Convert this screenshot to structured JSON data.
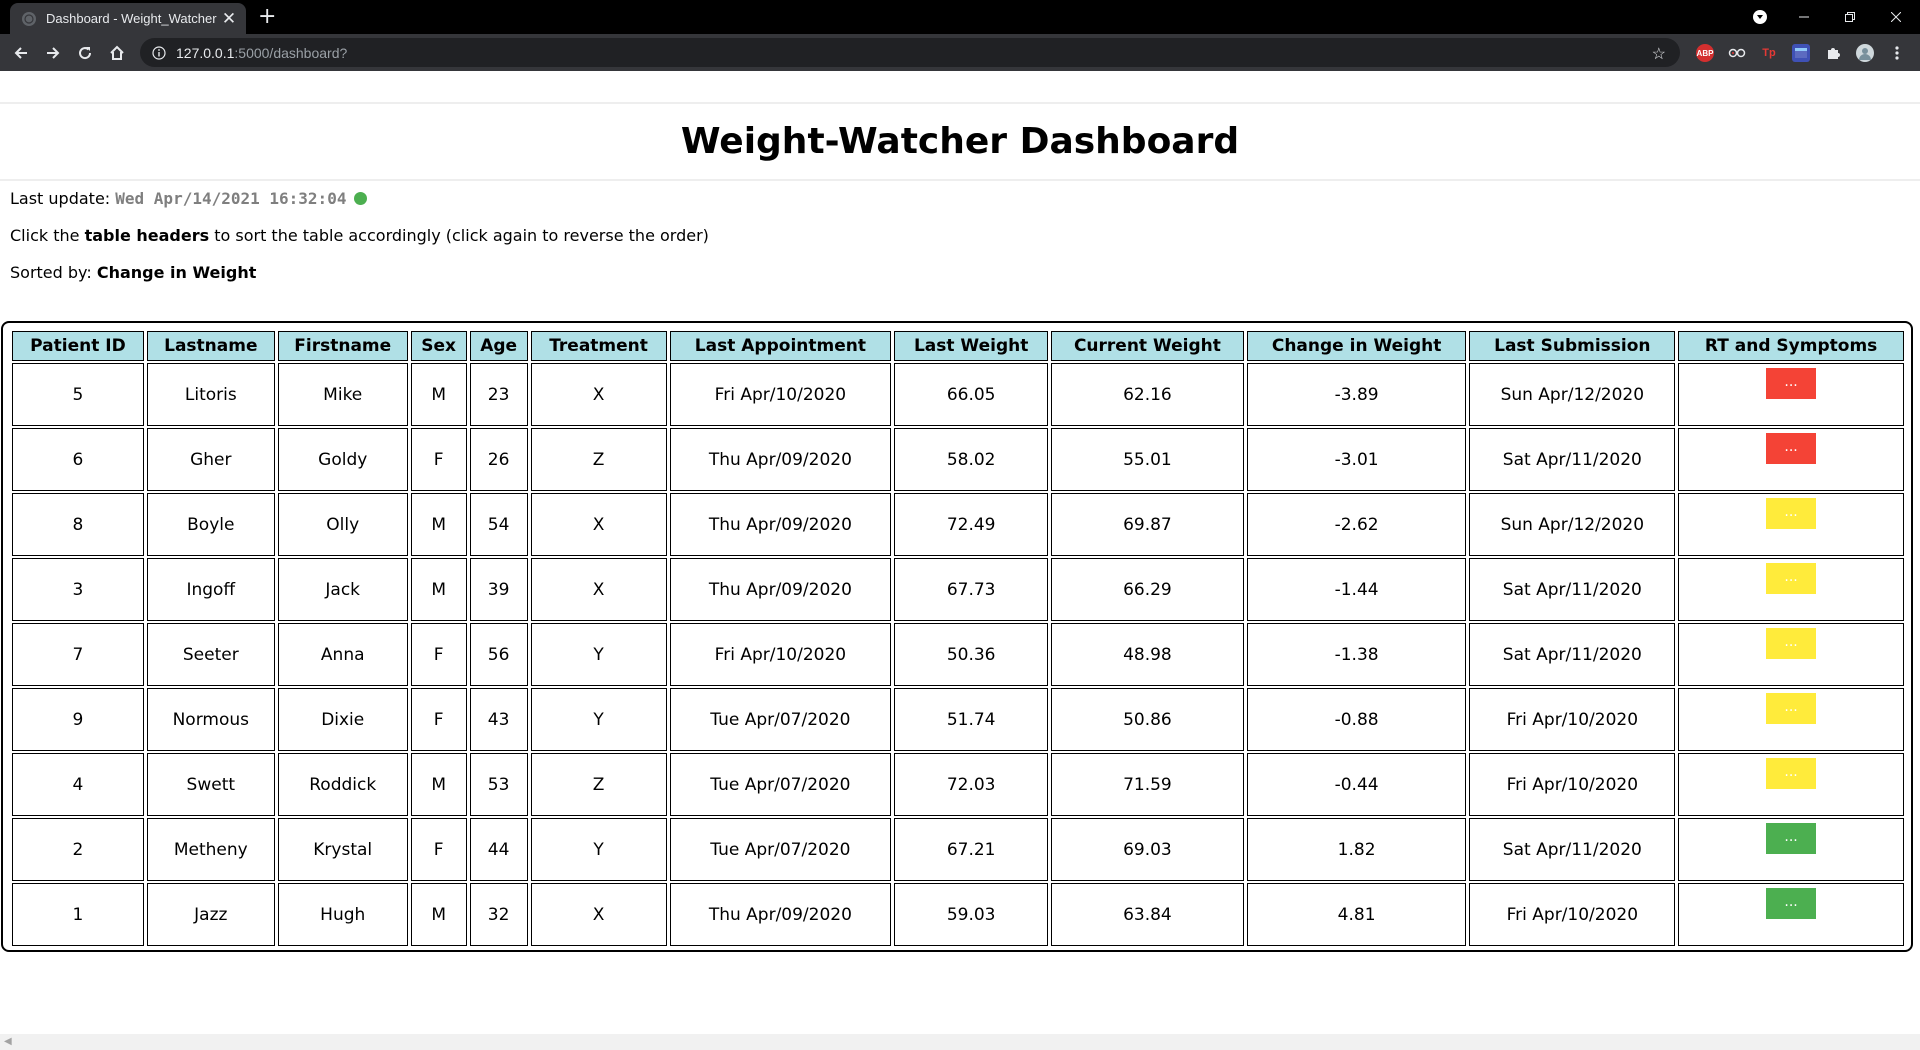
{
  "browser": {
    "tab_title": "Dashboard - Weight_Watcher",
    "tab_close": "✕",
    "new_tab": "+",
    "url_host": "127.0.0.1",
    "url_path": ":5000/dashboard?",
    "extensions": [
      "ABP",
      "Tp"
    ]
  },
  "page": {
    "title": "Weight-Watcher Dashboard",
    "last_update_label": "Last update: ",
    "last_update_value": "Wed Apr/14/2021 16:32:04",
    "status_color": "#4caf50",
    "instructions_pre": "Click the ",
    "instructions_bold": "table headers",
    "instructions_post": " to sort the table accordingly (click again to reverse the order)",
    "sorted_label": "Sorted by: ",
    "sorted_value": "Change in Weight"
  },
  "table": {
    "headers": [
      "Patient ID",
      "Lastname",
      "Firstname",
      "Sex",
      "Age",
      "Treatment",
      "Last Appointment",
      "Last Weight",
      "Current Weight",
      "Change in Weight",
      "Last Submission",
      "RT and Symptoms"
    ],
    "symptom_button_label": "...",
    "status_colors": {
      "red": "#f44336",
      "yellow": "#ffeb3b",
      "green": "#4caf50"
    },
    "rows": [
      {
        "id": "5",
        "lastname": "Litoris",
        "firstname": "Mike",
        "sex": "M",
        "age": "23",
        "treatment": "X",
        "last_appointment": "Fri Apr/10/2020",
        "last_weight": "66.05",
        "current_weight": "62.16",
        "change": "-3.89",
        "last_submission": "Sun Apr/12/2020",
        "status": "red"
      },
      {
        "id": "6",
        "lastname": "Gher",
        "firstname": "Goldy",
        "sex": "F",
        "age": "26",
        "treatment": "Z",
        "last_appointment": "Thu Apr/09/2020",
        "last_weight": "58.02",
        "current_weight": "55.01",
        "change": "-3.01",
        "last_submission": "Sat Apr/11/2020",
        "status": "red"
      },
      {
        "id": "8",
        "lastname": "Boyle",
        "firstname": "Olly",
        "sex": "M",
        "age": "54",
        "treatment": "X",
        "last_appointment": "Thu Apr/09/2020",
        "last_weight": "72.49",
        "current_weight": "69.87",
        "change": "-2.62",
        "last_submission": "Sun Apr/12/2020",
        "status": "yellow"
      },
      {
        "id": "3",
        "lastname": "Ingoff",
        "firstname": "Jack",
        "sex": "M",
        "age": "39",
        "treatment": "X",
        "last_appointment": "Thu Apr/09/2020",
        "last_weight": "67.73",
        "current_weight": "66.29",
        "change": "-1.44",
        "last_submission": "Sat Apr/11/2020",
        "status": "yellow"
      },
      {
        "id": "7",
        "lastname": "Seeter",
        "firstname": "Anna",
        "sex": "F",
        "age": "56",
        "treatment": "Y",
        "last_appointment": "Fri Apr/10/2020",
        "last_weight": "50.36",
        "current_weight": "48.98",
        "change": "-1.38",
        "last_submission": "Sat Apr/11/2020",
        "status": "yellow"
      },
      {
        "id": "9",
        "lastname": "Normous",
        "firstname": "Dixie",
        "sex": "F",
        "age": "43",
        "treatment": "Y",
        "last_appointment": "Tue Apr/07/2020",
        "last_weight": "51.74",
        "current_weight": "50.86",
        "change": "-0.88",
        "last_submission": "Fri Apr/10/2020",
        "status": "yellow"
      },
      {
        "id": "4",
        "lastname": "Swett",
        "firstname": "Roddick",
        "sex": "M",
        "age": "53",
        "treatment": "Z",
        "last_appointment": "Tue Apr/07/2020",
        "last_weight": "72.03",
        "current_weight": "71.59",
        "change": "-0.44",
        "last_submission": "Fri Apr/10/2020",
        "status": "yellow"
      },
      {
        "id": "2",
        "lastname": "Metheny",
        "firstname": "Krystal",
        "sex": "F",
        "age": "44",
        "treatment": "Y",
        "last_appointment": "Tue Apr/07/2020",
        "last_weight": "67.21",
        "current_weight": "69.03",
        "change": "1.82",
        "last_submission": "Sat Apr/11/2020",
        "status": "green"
      },
      {
        "id": "1",
        "lastname": "Jazz",
        "firstname": "Hugh",
        "sex": "M",
        "age": "32",
        "treatment": "X",
        "last_appointment": "Thu Apr/09/2020",
        "last_weight": "59.03",
        "current_weight": "63.84",
        "change": "4.81",
        "last_submission": "Fri Apr/10/2020",
        "status": "green"
      }
    ]
  }
}
